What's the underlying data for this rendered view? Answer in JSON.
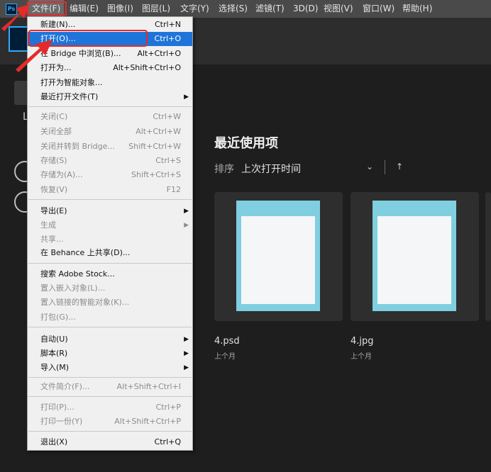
{
  "app": {
    "logo_text": "Ps"
  },
  "menubar": {
    "items": [
      {
        "label": "文件(F)"
      },
      {
        "label": "编辑(E)"
      },
      {
        "label": "图像(I)"
      },
      {
        "label": "图层(L)"
      },
      {
        "label": "文字(Y)"
      },
      {
        "label": "选择(S)"
      },
      {
        "label": "滤镜(T)"
      },
      {
        "label": "3D(D)"
      },
      {
        "label": "视图(V)"
      },
      {
        "label": "窗口(W)"
      },
      {
        "label": "帮助(H)"
      }
    ]
  },
  "file_menu": {
    "items": [
      {
        "label": "新建(N)...",
        "shortcut": "Ctrl+N"
      },
      {
        "label": "打开(O)...",
        "shortcut": "Ctrl+O"
      },
      {
        "label": "在 Bridge 中浏览(B)...",
        "shortcut": "Alt+Ctrl+O"
      },
      {
        "label": "打开为...",
        "shortcut": "Alt+Shift+Ctrl+O"
      },
      {
        "label": "打开为智能对象..."
      },
      {
        "label": "最近打开文件(T)"
      },
      {
        "label": "关闭(C)",
        "shortcut": "Ctrl+W"
      },
      {
        "label": "关闭全部",
        "shortcut": "Alt+Ctrl+W"
      },
      {
        "label": "关闭并转到 Bridge...",
        "shortcut": "Shift+Ctrl+W"
      },
      {
        "label": "存储(S)",
        "shortcut": "Ctrl+S"
      },
      {
        "label": "存储为(A)...",
        "shortcut": "Shift+Ctrl+S"
      },
      {
        "label": "恢复(V)",
        "shortcut": "F12"
      },
      {
        "label": "导出(E)"
      },
      {
        "label": "生成"
      },
      {
        "label": "共享..."
      },
      {
        "label": "在 Behance 上共享(D)..."
      },
      {
        "label": "搜索 Adobe Stock..."
      },
      {
        "label": "置入嵌入对象(L)..."
      },
      {
        "label": "置入链接的智能对象(K)..."
      },
      {
        "label": "打包(G)..."
      },
      {
        "label": "自动(U)"
      },
      {
        "label": "脚本(R)"
      },
      {
        "label": "导入(M)"
      },
      {
        "label": "文件简介(F)...",
        "shortcut": "Alt+Shift+Ctrl+I"
      },
      {
        "label": "打印(P)...",
        "shortcut": "Ctrl+P"
      },
      {
        "label": "打印一份(Y)",
        "shortcut": "Alt+Shift+Ctrl+P"
      },
      {
        "label": "退出(X)",
        "shortcut": "Ctrl+Q"
      }
    ]
  },
  "home": {
    "recent_title": "最近使用项",
    "sort_label": "排序",
    "sort_value": "上次打开时间",
    "files": [
      {
        "name": "4.psd",
        "date": "上个月"
      },
      {
        "name": "4.jpg",
        "date": "上个月"
      }
    ]
  },
  "colors": {
    "highlight": "#1e74d8",
    "annotation_red": "#e52a2a",
    "thumbnail_frame": "#7fcfe0"
  }
}
